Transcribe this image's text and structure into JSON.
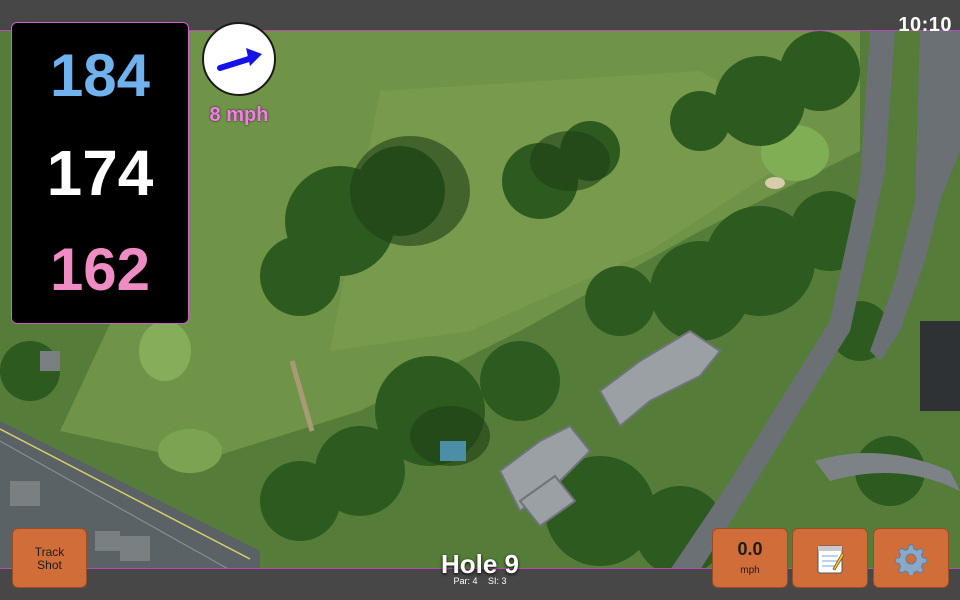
{
  "status": {
    "time": "10:10"
  },
  "yardage": {
    "back": "184",
    "center": "174",
    "front": "162"
  },
  "wind": {
    "speed": "8 mph",
    "icon": "wind-direction-arrow-icon",
    "arrow_color": "#1414e6"
  },
  "hole": {
    "title": "Hole 9",
    "par": "Par: 4",
    "si": "SI: 3"
  },
  "buttons": {
    "track_shot": {
      "line1": "Track",
      "line2": "Shot"
    },
    "speed": {
      "value": "0.0",
      "unit": "mph"
    },
    "notes": {
      "icon": "notepad-icon"
    },
    "settings": {
      "icon": "gear-icon"
    }
  },
  "colors": {
    "accent": "#d06d39",
    "frame": "#b94bb9",
    "back": "#6fb2ee",
    "front": "#f08cc4",
    "wind": "#f07fe6"
  }
}
